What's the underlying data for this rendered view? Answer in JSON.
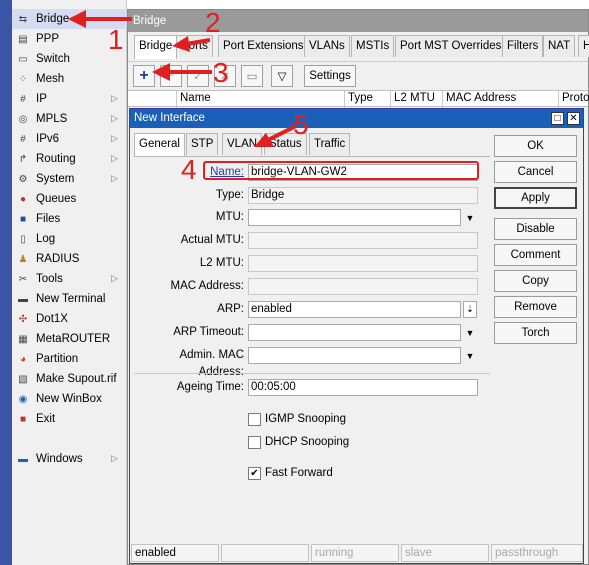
{
  "menu": {
    "items": [
      {
        "label": "Bridge",
        "icon": "bridge-icon",
        "arrow": false,
        "selected": true
      },
      {
        "label": "PPP",
        "icon": "ppp-icon",
        "arrow": false
      },
      {
        "label": "Switch",
        "icon": "switch-icon",
        "arrow": false
      },
      {
        "label": "Mesh",
        "icon": "mesh-icon",
        "arrow": false
      },
      {
        "label": "IP",
        "icon": "ip-icon",
        "arrow": true
      },
      {
        "label": "MPLS",
        "icon": "mpls-icon",
        "arrow": true
      },
      {
        "label": "IPv6",
        "icon": "ipv6-icon",
        "arrow": true
      },
      {
        "label": "Routing",
        "icon": "routing-icon",
        "arrow": true
      },
      {
        "label": "System",
        "icon": "system-icon",
        "arrow": true
      },
      {
        "label": "Queues",
        "icon": "queues-icon",
        "arrow": false
      },
      {
        "label": "Files",
        "icon": "files-icon",
        "arrow": false
      },
      {
        "label": "Log",
        "icon": "log-icon",
        "arrow": false
      },
      {
        "label": "RADIUS",
        "icon": "radius-icon",
        "arrow": false
      },
      {
        "label": "Tools",
        "icon": "tools-icon",
        "arrow": true
      },
      {
        "label": "New Terminal",
        "icon": "terminal-icon",
        "arrow": false
      },
      {
        "label": "Dot1X",
        "icon": "dot1x-icon",
        "arrow": false
      },
      {
        "label": "MetaROUTER",
        "icon": "metarouter-icon",
        "arrow": false
      },
      {
        "label": "Partition",
        "icon": "partition-icon",
        "arrow": false
      },
      {
        "label": "Make Supout.rif",
        "icon": "supout-icon",
        "arrow": false
      },
      {
        "label": "New WinBox",
        "icon": "winbox-icon",
        "arrow": false
      },
      {
        "label": "Exit",
        "icon": "exit-icon",
        "arrow": false
      },
      {
        "label": "Windows",
        "icon": "windows-icon",
        "arrow": true
      }
    ]
  },
  "bridge_window": {
    "title": "Bridge",
    "tabs": [
      "Bridge",
      "Ports",
      "Port Extensions",
      "VLANs",
      "MSTIs",
      "Port MST Overrides",
      "Filters",
      "NAT",
      "H"
    ],
    "settings_label": "Settings",
    "columns": [
      "",
      "Name",
      "Type",
      "L2 MTU",
      "MAC Address",
      "Protoco"
    ],
    "status": [
      "enabled",
      "",
      "running",
      "slave",
      "passthrough"
    ]
  },
  "dialog": {
    "title": "New Interface",
    "tabs": [
      "General",
      "STP",
      "VLAN",
      "Status",
      "Traffic"
    ],
    "fields": {
      "name_label": "Name:",
      "name_value": "bridge-VLAN-GW2",
      "type_label": "Type:",
      "type_value": "Bridge",
      "mtu_label": "MTU:",
      "mtu_value": "",
      "actual_mtu_label": "Actual MTU:",
      "actual_mtu_value": "",
      "l2mtu_label": "L2 MTU:",
      "l2mtu_value": "",
      "mac_label": "MAC Address:",
      "mac_value": "",
      "arp_label": "ARP:",
      "arp_value": "enabled",
      "arp_timeout_label": "ARP Timeout:",
      "arp_timeout_value": "",
      "admin_mac_label": "Admin. MAC Address:",
      "admin_mac_value": "",
      "ageing_label": "Ageing Time:",
      "ageing_value": "00:05:00"
    },
    "checkboxes": {
      "igmp": "IGMP Snooping",
      "igmp_checked": false,
      "dhcp": "DHCP Snooping",
      "dhcp_checked": false,
      "fast": "Fast Forward",
      "fast_checked": true
    },
    "buttons": [
      "OK",
      "Cancel",
      "Apply",
      "Disable",
      "Comment",
      "Copy",
      "Remove",
      "Torch"
    ],
    "status": [
      "enabled",
      "",
      "running",
      "slave",
      "passthrough"
    ]
  },
  "annotations": [
    "1",
    "2",
    "3",
    "4",
    "5"
  ],
  "colors": {
    "annotation": "#e02020",
    "title_active": "#1a5fb8",
    "nav_bar": "#3a55a6"
  }
}
